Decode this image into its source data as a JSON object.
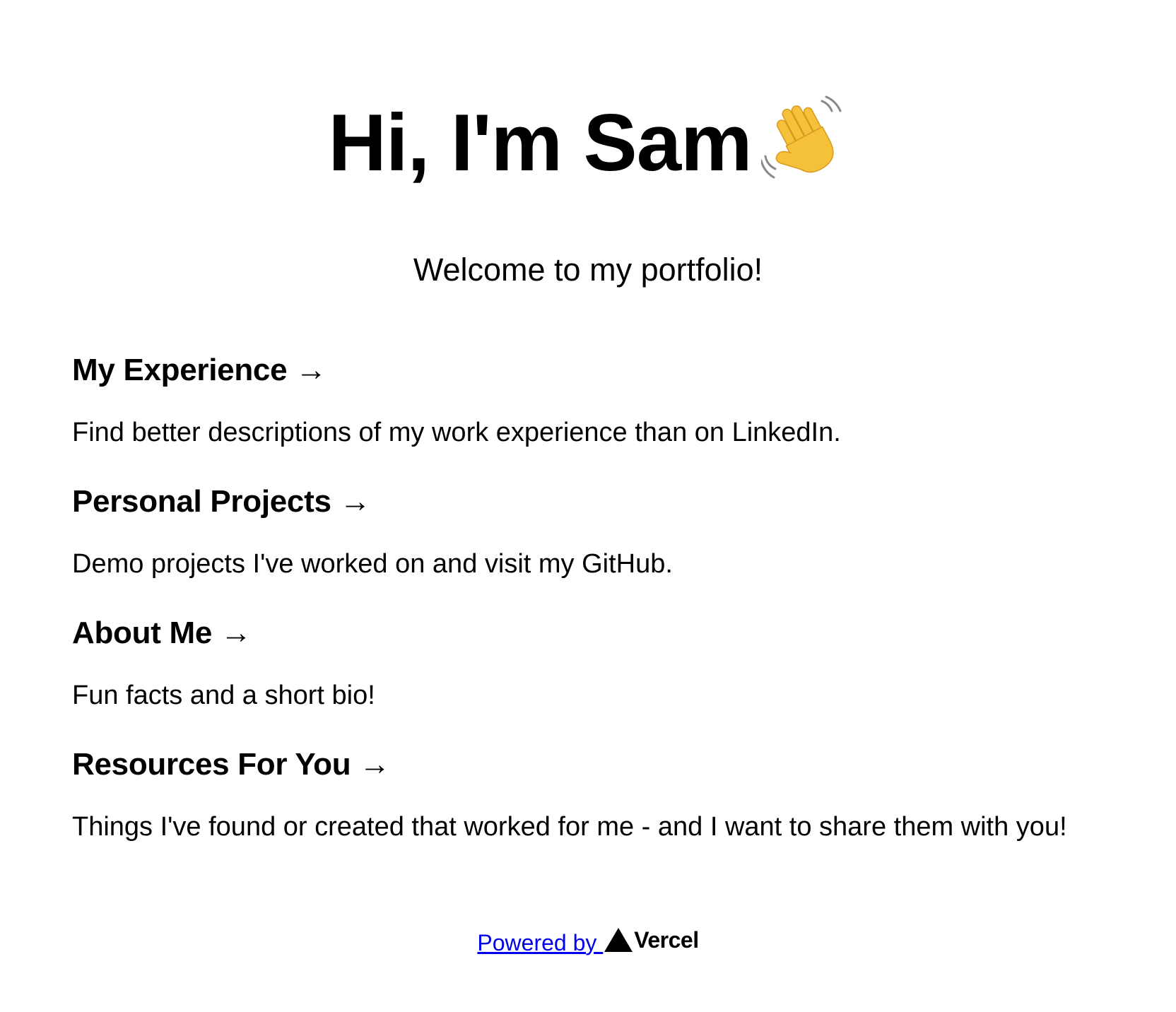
{
  "hero": {
    "title": "Hi, I'm Sam",
    "emoji_icon": "waving-hand-icon"
  },
  "subtitle": "Welcome to my portfolio!",
  "cards": [
    {
      "heading": "My Experience",
      "arrow": "→",
      "description": "Find better descriptions of my work experience than on LinkedIn."
    },
    {
      "heading": "Personal Projects",
      "arrow": "→",
      "description": "Demo projects I've worked on and visit my GitHub."
    },
    {
      "heading": "About Me",
      "arrow": "→",
      "description": "Fun facts and a short bio!"
    },
    {
      "heading": "Resources For You",
      "arrow": "→",
      "description": "Things I've found or created that worked for me - and I want to share them with you!"
    }
  ],
  "footer": {
    "powered_by": "Powered by ",
    "brand": "Vercel",
    "brand_icon": "vercel-triangle-icon",
    "link_color": "#0000ee"
  }
}
